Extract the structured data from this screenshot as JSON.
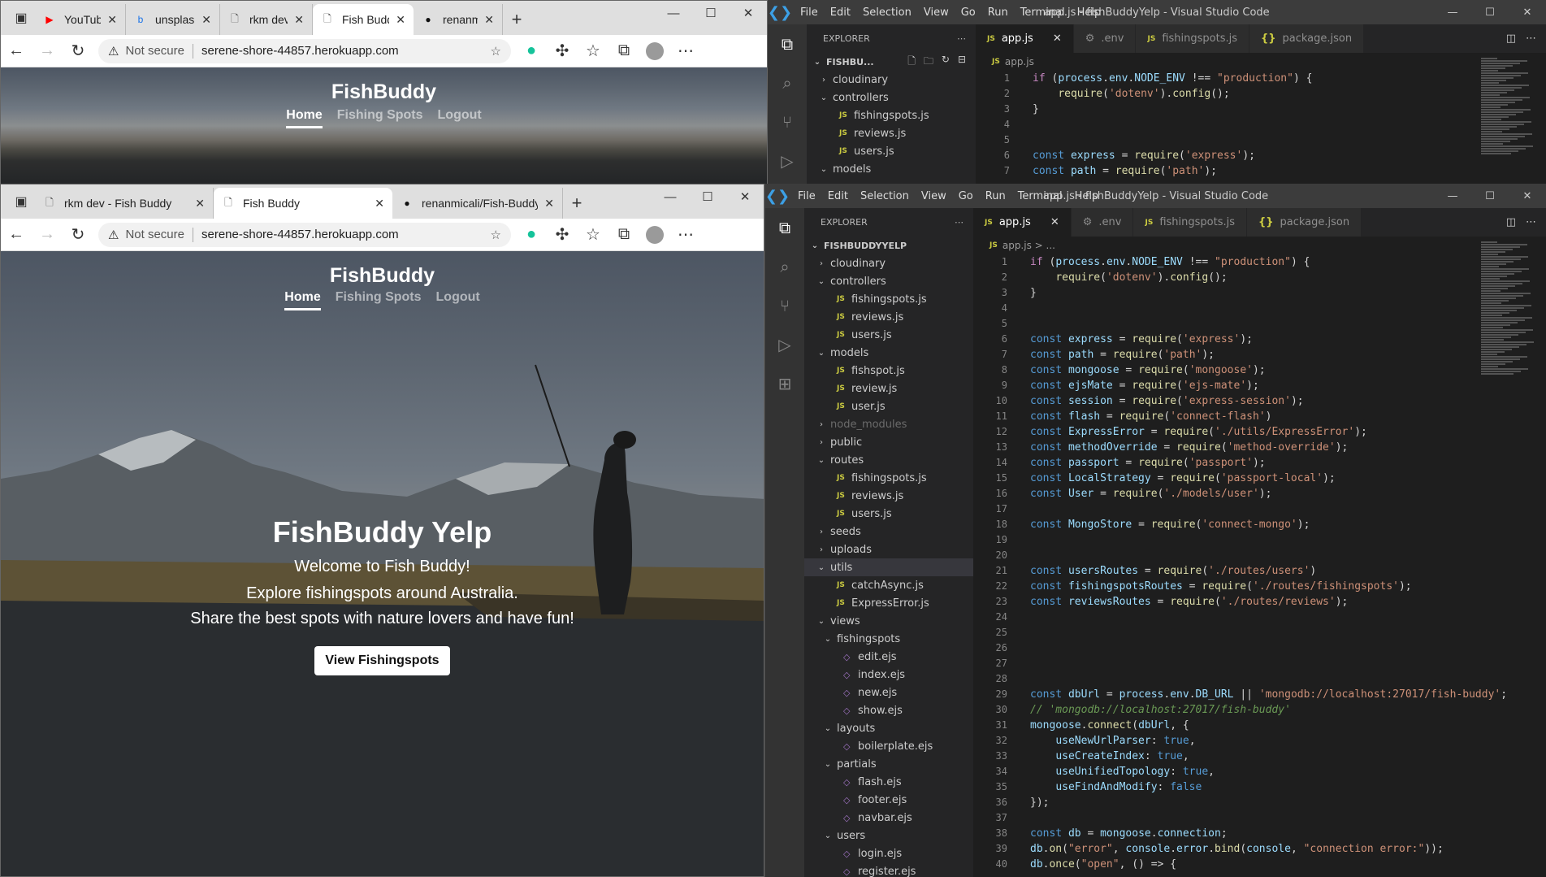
{
  "browser_back": {
    "tabs": [
      {
        "title": "YouTube",
        "favicon": "youtube-icon"
      },
      {
        "title": "unsplash - Bi",
        "favicon": "bing-icon"
      },
      {
        "title": "rkm dev - Fis",
        "favicon": "page-icon"
      },
      {
        "title": "Fish Buddy",
        "favicon": "page-icon",
        "active": true
      },
      {
        "title": "renanmicali/F",
        "favicon": "github-icon"
      }
    ],
    "address": {
      "warning": "Not secure",
      "url": "serene-shore-44857.herokuapp.com"
    },
    "brand": "FishBuddy",
    "nav": [
      "Home",
      "Fishing Spots",
      "Logout"
    ]
  },
  "browser_front": {
    "tabs": [
      {
        "title": "rkm dev - Fish Buddy",
        "favicon": "page-icon"
      },
      {
        "title": "Fish Buddy",
        "favicon": "page-icon",
        "active": true
      },
      {
        "title": "renanmicali/Fish-Buddy-: full C",
        "favicon": "github-icon"
      }
    ],
    "address": {
      "warning": "Not secure",
      "url": "serene-shore-44857.herokuapp.com"
    },
    "brand": "FishBuddy",
    "nav": [
      "Home",
      "Fishing Spots",
      "Logout"
    ],
    "hero": {
      "title": "FishBuddy Yelp",
      "line1": "Welcome to Fish Buddy!",
      "line2": "Explore fishingspots around Australia.",
      "line3": "Share the best spots with nature lovers and have fun!",
      "button": "View Fishingspots"
    }
  },
  "vscode_back": {
    "menu": [
      "File",
      "Edit",
      "Selection",
      "View",
      "Go",
      "Run",
      "Terminal",
      "Help"
    ],
    "window_title": "app.js - fishBuddyYelp - Visual Studio Code",
    "explorer_label": "EXPLORER",
    "root": "FISHBU...",
    "tabs": [
      "app.js",
      ".env",
      "fishingspots.js",
      "package.json"
    ],
    "breadcrumb": "app.js",
    "tree": [
      {
        "label": "cloudinary",
        "type": "folder",
        "open": false,
        "depth": 1
      },
      {
        "label": "controllers",
        "type": "folder",
        "open": true,
        "depth": 1
      },
      {
        "label": "fishingspots.js",
        "type": "js",
        "depth": 2
      },
      {
        "label": "reviews.js",
        "type": "js",
        "depth": 2
      },
      {
        "label": "users.js",
        "type": "js",
        "depth": 2
      },
      {
        "label": "models",
        "type": "folder",
        "open": true,
        "depth": 1
      }
    ]
  },
  "vscode_front": {
    "menu": [
      "File",
      "Edit",
      "Selection",
      "View",
      "Go",
      "Run",
      "Terminal",
      "Help"
    ],
    "window_title": "app.js - fishBuddyYelp - Visual Studio Code",
    "explorer_label": "EXPLORER",
    "tabs": [
      "app.js",
      ".env",
      "fishingspots.js",
      "package.json"
    ],
    "breadcrumb": "app.js > ...",
    "tree": [
      {
        "label": "FISHBUDDYYELP",
        "type": "root",
        "open": true,
        "depth": 0
      },
      {
        "label": "cloudinary",
        "type": "folder",
        "open": false,
        "depth": 1
      },
      {
        "label": "controllers",
        "type": "folder",
        "open": true,
        "depth": 1
      },
      {
        "label": "fishingspots.js",
        "type": "js",
        "depth": 2
      },
      {
        "label": "reviews.js",
        "type": "js",
        "depth": 2
      },
      {
        "label": "users.js",
        "type": "js",
        "depth": 2
      },
      {
        "label": "models",
        "type": "folder",
        "open": true,
        "depth": 1
      },
      {
        "label": "fishspot.js",
        "type": "js",
        "depth": 2
      },
      {
        "label": "review.js",
        "type": "js",
        "depth": 2
      },
      {
        "label": "user.js",
        "type": "js",
        "depth": 2
      },
      {
        "label": "node_modules",
        "type": "folder",
        "open": false,
        "depth": 1,
        "dim": true
      },
      {
        "label": "public",
        "type": "folder",
        "open": false,
        "depth": 1
      },
      {
        "label": "routes",
        "type": "folder",
        "open": true,
        "depth": 1
      },
      {
        "label": "fishingspots.js",
        "type": "js",
        "depth": 2
      },
      {
        "label": "reviews.js",
        "type": "js",
        "depth": 2
      },
      {
        "label": "users.js",
        "type": "js",
        "depth": 2
      },
      {
        "label": "seeds",
        "type": "folder",
        "open": false,
        "depth": 1
      },
      {
        "label": "uploads",
        "type": "folder",
        "open": false,
        "depth": 1
      },
      {
        "label": "utils",
        "type": "folder",
        "open": true,
        "depth": 1,
        "selected": true
      },
      {
        "label": "catchAsync.js",
        "type": "js",
        "depth": 2
      },
      {
        "label": "ExpressError.js",
        "type": "js",
        "depth": 2
      },
      {
        "label": "views",
        "type": "folder",
        "open": true,
        "depth": 1
      },
      {
        "label": "fishingspots",
        "type": "folder",
        "open": true,
        "depth": 2
      },
      {
        "label": "edit.ejs",
        "type": "ejs",
        "depth": 3
      },
      {
        "label": "index.ejs",
        "type": "ejs",
        "depth": 3
      },
      {
        "label": "new.ejs",
        "type": "ejs",
        "depth": 3
      },
      {
        "label": "show.ejs",
        "type": "ejs",
        "depth": 3
      },
      {
        "label": "layouts",
        "type": "folder",
        "open": true,
        "depth": 2
      },
      {
        "label": "boilerplate.ejs",
        "type": "ejs",
        "depth": 3
      },
      {
        "label": "partials",
        "type": "folder",
        "open": true,
        "depth": 2
      },
      {
        "label": "flash.ejs",
        "type": "ejs",
        "depth": 3
      },
      {
        "label": "footer.ejs",
        "type": "ejs",
        "depth": 3
      },
      {
        "label": "navbar.ejs",
        "type": "ejs",
        "depth": 3
      },
      {
        "label": "users",
        "type": "folder",
        "open": true,
        "depth": 2
      },
      {
        "label": "login.ejs",
        "type": "ejs",
        "depth": 3
      },
      {
        "label": "register.ejs",
        "type": "ejs",
        "depth": 3
      }
    ],
    "code": [
      [
        [
          "kc",
          "if"
        ],
        [
          "pn",
          " ("
        ],
        [
          "vr",
          "process"
        ],
        [
          "pn",
          "."
        ],
        [
          "vr",
          "env"
        ],
        [
          "pn",
          "."
        ],
        [
          "vr",
          "NODE_ENV"
        ],
        [
          "pn",
          " !== "
        ],
        [
          "st",
          "\"production\""
        ],
        [
          "pn",
          ") {"
        ]
      ],
      [
        [
          "pn",
          "    "
        ],
        [
          "fn",
          "require"
        ],
        [
          "pn",
          "("
        ],
        [
          "st",
          "'dotenv'"
        ],
        [
          "pn",
          ")."
        ],
        [
          "fn",
          "config"
        ],
        [
          "pn",
          "();"
        ]
      ],
      [
        [
          "pn",
          "}"
        ]
      ],
      [],
      [],
      [
        [
          "kw",
          "const"
        ],
        [
          "pn",
          " "
        ],
        [
          "vr",
          "express"
        ],
        [
          "pn",
          " = "
        ],
        [
          "fn",
          "require"
        ],
        [
          "pn",
          "("
        ],
        [
          "st",
          "'express'"
        ],
        [
          "pn",
          ");"
        ]
      ],
      [
        [
          "kw",
          "const"
        ],
        [
          "pn",
          " "
        ],
        [
          "vr",
          "path"
        ],
        [
          "pn",
          " = "
        ],
        [
          "fn",
          "require"
        ],
        [
          "pn",
          "("
        ],
        [
          "st",
          "'path'"
        ],
        [
          "pn",
          ");"
        ]
      ],
      [
        [
          "kw",
          "const"
        ],
        [
          "pn",
          " "
        ],
        [
          "vr",
          "mongoose"
        ],
        [
          "pn",
          " = "
        ],
        [
          "fn",
          "require"
        ],
        [
          "pn",
          "("
        ],
        [
          "st",
          "'mongoose'"
        ],
        [
          "pn",
          ");"
        ]
      ],
      [
        [
          "kw",
          "const"
        ],
        [
          "pn",
          " "
        ],
        [
          "vr",
          "ejsMate"
        ],
        [
          "pn",
          " = "
        ],
        [
          "fn",
          "require"
        ],
        [
          "pn",
          "("
        ],
        [
          "st",
          "'ejs-mate'"
        ],
        [
          "pn",
          ");"
        ]
      ],
      [
        [
          "kw",
          "const"
        ],
        [
          "pn",
          " "
        ],
        [
          "vr",
          "session"
        ],
        [
          "pn",
          " = "
        ],
        [
          "fn",
          "require"
        ],
        [
          "pn",
          "("
        ],
        [
          "st",
          "'express-session'"
        ],
        [
          "pn",
          ");"
        ]
      ],
      [
        [
          "kw",
          "const"
        ],
        [
          "pn",
          " "
        ],
        [
          "vr",
          "flash"
        ],
        [
          "pn",
          " = "
        ],
        [
          "fn",
          "require"
        ],
        [
          "pn",
          "("
        ],
        [
          "st",
          "'connect-flash'"
        ],
        [
          "pn",
          ")"
        ]
      ],
      [
        [
          "kw",
          "const"
        ],
        [
          "pn",
          " "
        ],
        [
          "vr",
          "ExpressError"
        ],
        [
          "pn",
          " = "
        ],
        [
          "fn",
          "require"
        ],
        [
          "pn",
          "("
        ],
        [
          "st",
          "'./utils/ExpressError'"
        ],
        [
          "pn",
          ");"
        ]
      ],
      [
        [
          "kw",
          "const"
        ],
        [
          "pn",
          " "
        ],
        [
          "vr",
          "methodOverride"
        ],
        [
          "pn",
          " = "
        ],
        [
          "fn",
          "require"
        ],
        [
          "pn",
          "("
        ],
        [
          "st",
          "'method-override'"
        ],
        [
          "pn",
          ");"
        ]
      ],
      [
        [
          "kw",
          "const"
        ],
        [
          "pn",
          " "
        ],
        [
          "vr",
          "passport"
        ],
        [
          "pn",
          " = "
        ],
        [
          "fn",
          "require"
        ],
        [
          "pn",
          "("
        ],
        [
          "st",
          "'passport'"
        ],
        [
          "pn",
          ");"
        ]
      ],
      [
        [
          "kw",
          "const"
        ],
        [
          "pn",
          " "
        ],
        [
          "vr",
          "LocalStrategy"
        ],
        [
          "pn",
          " = "
        ],
        [
          "fn",
          "require"
        ],
        [
          "pn",
          "("
        ],
        [
          "st",
          "'passport-local'"
        ],
        [
          "pn",
          ");"
        ]
      ],
      [
        [
          "kw",
          "const"
        ],
        [
          "pn",
          " "
        ],
        [
          "vr",
          "User"
        ],
        [
          "pn",
          " = "
        ],
        [
          "fn",
          "require"
        ],
        [
          "pn",
          "("
        ],
        [
          "st",
          "'./models/user'"
        ],
        [
          "pn",
          ");"
        ]
      ],
      [],
      [
        [
          "kw",
          "const"
        ],
        [
          "pn",
          " "
        ],
        [
          "vr",
          "MongoStore"
        ],
        [
          "pn",
          " = "
        ],
        [
          "fn",
          "require"
        ],
        [
          "pn",
          "("
        ],
        [
          "st",
          "'connect-mongo'"
        ],
        [
          "pn",
          ");"
        ]
      ],
      [],
      [],
      [
        [
          "kw",
          "const"
        ],
        [
          "pn",
          " "
        ],
        [
          "vr",
          "usersRoutes"
        ],
        [
          "pn",
          " = "
        ],
        [
          "fn",
          "require"
        ],
        [
          "pn",
          "("
        ],
        [
          "st",
          "'./routes/users'"
        ],
        [
          "pn",
          ")"
        ]
      ],
      [
        [
          "kw",
          "const"
        ],
        [
          "pn",
          " "
        ],
        [
          "vr",
          "fishingspotsRoutes"
        ],
        [
          "pn",
          " = "
        ],
        [
          "fn",
          "require"
        ],
        [
          "pn",
          "("
        ],
        [
          "st",
          "'./routes/fishingspots'"
        ],
        [
          "pn",
          ");"
        ]
      ],
      [
        [
          "kw",
          "const"
        ],
        [
          "pn",
          " "
        ],
        [
          "vr",
          "reviewsRoutes"
        ],
        [
          "pn",
          " = "
        ],
        [
          "fn",
          "require"
        ],
        [
          "pn",
          "("
        ],
        [
          "st",
          "'./routes/reviews'"
        ],
        [
          "pn",
          ");"
        ]
      ],
      [],
      [],
      [],
      [],
      [],
      [
        [
          "kw",
          "const"
        ],
        [
          "pn",
          " "
        ],
        [
          "vr",
          "dbUrl"
        ],
        [
          "pn",
          " = "
        ],
        [
          "vr",
          "process"
        ],
        [
          "pn",
          "."
        ],
        [
          "vr",
          "env"
        ],
        [
          "pn",
          "."
        ],
        [
          "vr",
          "DB_URL"
        ],
        [
          "pn",
          " || "
        ],
        [
          "st",
          "'mongodb://localhost:27017/fish-buddy'"
        ],
        [
          "pn",
          ";"
        ]
      ],
      [
        [
          "cm",
          "// 'mongodb://localhost:27017/fish-buddy'"
        ]
      ],
      [
        [
          "vr",
          "mongoose"
        ],
        [
          "pn",
          "."
        ],
        [
          "fn",
          "connect"
        ],
        [
          "pn",
          "("
        ],
        [
          "vr",
          "dbUrl"
        ],
        [
          "pn",
          ", {"
        ]
      ],
      [
        [
          "pn",
          "    "
        ],
        [
          "vr",
          "useNewUrlParser"
        ],
        [
          "pn",
          ": "
        ],
        [
          "kw",
          "true"
        ],
        [
          "pn",
          ","
        ]
      ],
      [
        [
          "pn",
          "    "
        ],
        [
          "vr",
          "useCreateIndex"
        ],
        [
          "pn",
          ": "
        ],
        [
          "kw",
          "true"
        ],
        [
          "pn",
          ","
        ]
      ],
      [
        [
          "pn",
          "    "
        ],
        [
          "vr",
          "useUnifiedTopology"
        ],
        [
          "pn",
          ": "
        ],
        [
          "kw",
          "true"
        ],
        [
          "pn",
          ","
        ]
      ],
      [
        [
          "pn",
          "    "
        ],
        [
          "vr",
          "useFindAndModify"
        ],
        [
          "pn",
          ": "
        ],
        [
          "kw",
          "false"
        ]
      ],
      [
        [
          "pn",
          "});"
        ]
      ],
      [],
      [
        [
          "kw",
          "const"
        ],
        [
          "pn",
          " "
        ],
        [
          "vr",
          "db"
        ],
        [
          "pn",
          " = "
        ],
        [
          "vr",
          "mongoose"
        ],
        [
          "pn",
          "."
        ],
        [
          "vr",
          "connection"
        ],
        [
          "pn",
          ";"
        ]
      ],
      [
        [
          "vr",
          "db"
        ],
        [
          "pn",
          "."
        ],
        [
          "fn",
          "on"
        ],
        [
          "pn",
          "("
        ],
        [
          "st",
          "\"error\""
        ],
        [
          "pn",
          ", "
        ],
        [
          "vr",
          "console"
        ],
        [
          "pn",
          "."
        ],
        [
          "vr",
          "error"
        ],
        [
          "pn",
          "."
        ],
        [
          "fn",
          "bind"
        ],
        [
          "pn",
          "("
        ],
        [
          "vr",
          "console"
        ],
        [
          "pn",
          ", "
        ],
        [
          "st",
          "\"connection error:\""
        ],
        [
          "pn",
          "));"
        ]
      ],
      [
        [
          "vr",
          "db"
        ],
        [
          "pn",
          "."
        ],
        [
          "fn",
          "once"
        ],
        [
          "pn",
          "("
        ],
        [
          "st",
          "\"open\""
        ],
        [
          "pn",
          ", () => {"
        ]
      ]
    ]
  }
}
